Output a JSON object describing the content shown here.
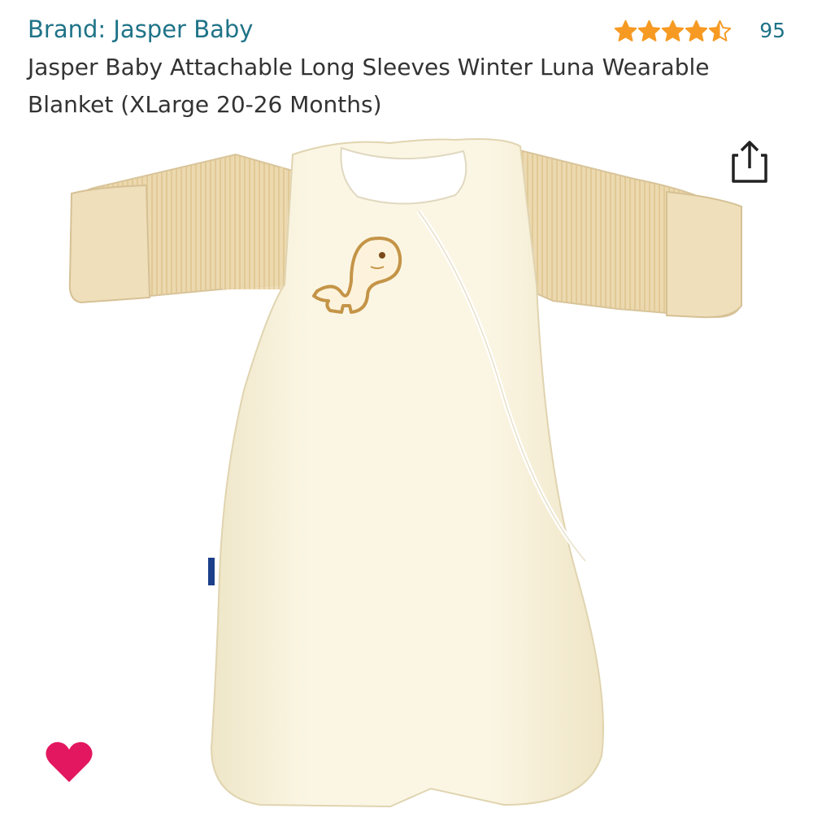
{
  "brand": {
    "label": "Brand: Jasper Baby"
  },
  "rating": {
    "stars": 4.5,
    "max_stars": 5,
    "count": "95",
    "star_color": "#f79a23"
  },
  "product": {
    "title": "Jasper Baby Attachable Long Sleeves Winter Luna Wearable Blanket (XLarge 20-26 Months)"
  },
  "icons": {
    "share": "share-icon",
    "wishlist": "heart-icon"
  },
  "colors": {
    "link": "#1f7388",
    "title_text": "#333333",
    "heart": "#e3175f",
    "garment_body": "#f7f0d8",
    "garment_sleeve": "#ead7ad"
  }
}
